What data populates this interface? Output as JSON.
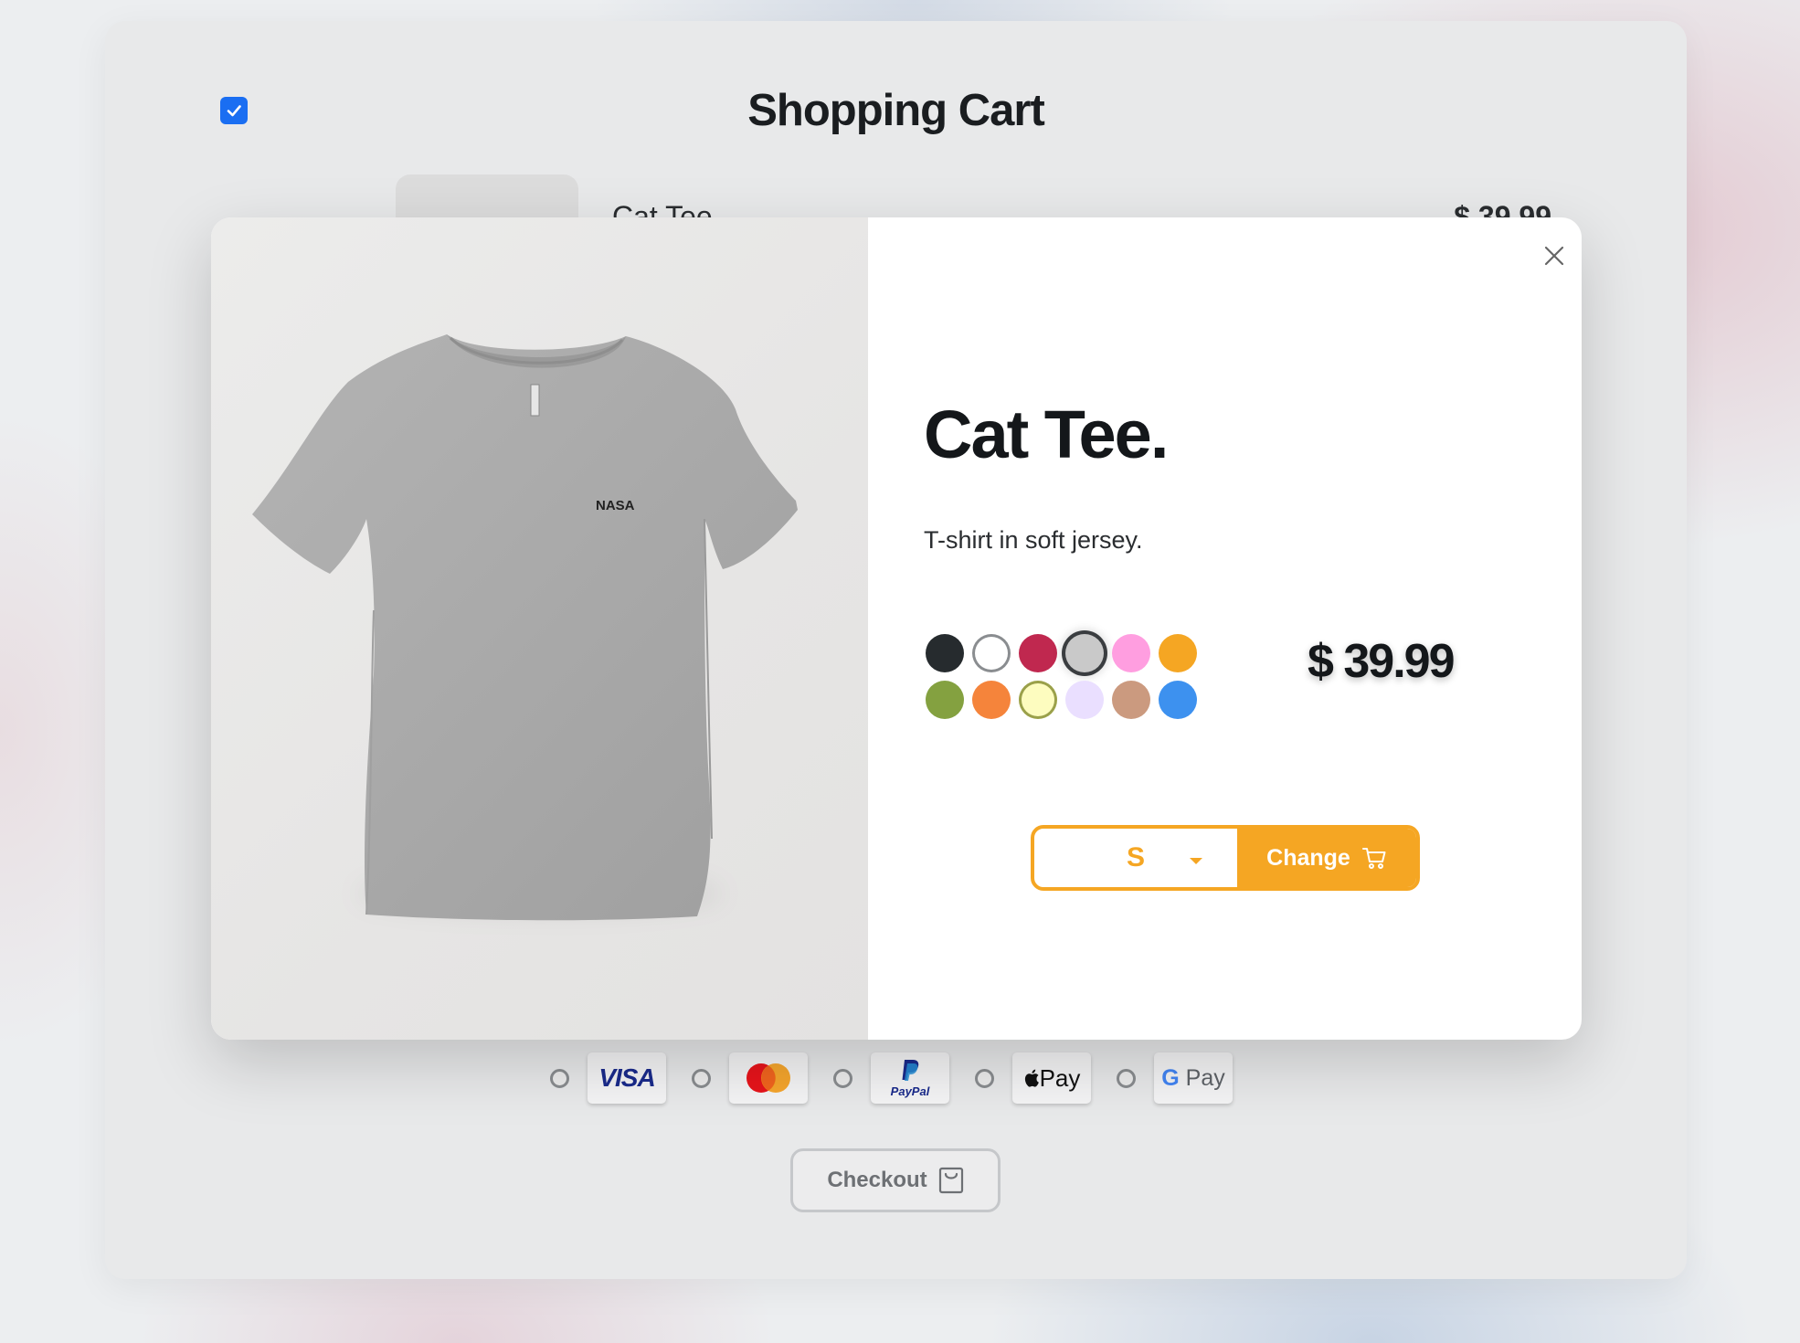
{
  "cart": {
    "title": "Shopping Cart",
    "select_all_checked": true,
    "item": {
      "name": "Cat Tee",
      "price": "$ 39.99"
    },
    "payment_methods": [
      {
        "name": "visa",
        "label": "VISA"
      },
      {
        "name": "mastercard",
        "label": ""
      },
      {
        "name": "paypal",
        "label": "PayPal"
      },
      {
        "name": "apple-pay",
        "label": "Pay"
      },
      {
        "name": "google-pay",
        "label_g": "G",
        "label": "Pay"
      }
    ],
    "checkout_label": "Checkout"
  },
  "modal": {
    "product_title": "Cat Tee.",
    "product_description": "T-shirt in soft jersey.",
    "price": "$ 39.99",
    "colors": [
      {
        "name": "black",
        "hex": "#262b2e"
      },
      {
        "name": "white",
        "hex": "#ffffff"
      },
      {
        "name": "crimson",
        "hex": "#c0284f"
      },
      {
        "name": "grey",
        "hex": "#c9c9c9",
        "selected": true
      },
      {
        "name": "pink",
        "hex": "#ff9ee0"
      },
      {
        "name": "amber",
        "hex": "#f5a623"
      },
      {
        "name": "olive",
        "hex": "#84a140"
      },
      {
        "name": "orange",
        "hex": "#f5843b"
      },
      {
        "name": "cream",
        "hex": "#fdfcbf"
      },
      {
        "name": "lavender",
        "hex": "#eadfff"
      },
      {
        "name": "tan",
        "hex": "#cb9a7f"
      },
      {
        "name": "blue",
        "hex": "#3d91ef"
      }
    ],
    "size": "S",
    "change_label": "Change",
    "tee_print": "NASA"
  },
  "accent_color": "#f5a623"
}
